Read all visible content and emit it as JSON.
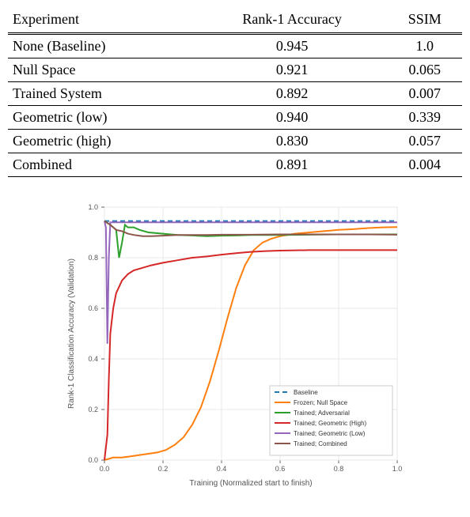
{
  "table": {
    "headers": [
      "Experiment",
      "Rank-1 Accuracy",
      "SSIM"
    ],
    "rows": [
      {
        "name": "None (Baseline)",
        "rank1": "0.945",
        "ssim": "1.0"
      },
      {
        "name": "Null Space",
        "rank1": "0.921",
        "ssim": "0.065"
      },
      {
        "name": "Trained System",
        "rank1": "0.892",
        "ssim": "0.007"
      },
      {
        "name": "Geometric (low)",
        "rank1": "0.940",
        "ssim": "0.339"
      },
      {
        "name": "Geometric (high)",
        "rank1": "0.830",
        "ssim": "0.057"
      },
      {
        "name": "Combined",
        "rank1": "0.891",
        "ssim": "0.004"
      }
    ]
  },
  "chart_data": {
    "type": "line",
    "title": "",
    "xlabel": "Training (Normalized start to finish)",
    "ylabel": "Rank-1 Classification Accuracy (Validation)",
    "xlim": [
      0.0,
      1.0
    ],
    "ylim": [
      0.0,
      1.0
    ],
    "xticks": [
      0.0,
      0.2,
      0.4,
      0.6,
      0.8,
      1.0
    ],
    "yticks": [
      0.0,
      0.2,
      0.4,
      0.6,
      0.8,
      1.0
    ],
    "series": [
      {
        "name": "Baseline",
        "color": "#1f77b4",
        "dash": "6,4",
        "data": [
          [
            0.0,
            0.945
          ],
          [
            1.0,
            0.945
          ]
        ]
      },
      {
        "name": "Frozen; Null Space",
        "color": "#ff7f0e",
        "dash": "",
        "data": [
          [
            0.0,
            0.0
          ],
          [
            0.03,
            0.01
          ],
          [
            0.06,
            0.01
          ],
          [
            0.09,
            0.015
          ],
          [
            0.12,
            0.02
          ],
          [
            0.15,
            0.025
          ],
          [
            0.18,
            0.03
          ],
          [
            0.21,
            0.04
          ],
          [
            0.24,
            0.06
          ],
          [
            0.27,
            0.09
          ],
          [
            0.3,
            0.14
          ],
          [
            0.33,
            0.21
          ],
          [
            0.36,
            0.31
          ],
          [
            0.39,
            0.43
          ],
          [
            0.42,
            0.56
          ],
          [
            0.45,
            0.68
          ],
          [
            0.48,
            0.77
          ],
          [
            0.51,
            0.83
          ],
          [
            0.54,
            0.86
          ],
          [
            0.57,
            0.875
          ],
          [
            0.6,
            0.885
          ],
          [
            0.65,
            0.895
          ],
          [
            0.7,
            0.9
          ],
          [
            0.75,
            0.905
          ],
          [
            0.8,
            0.91
          ],
          [
            0.85,
            0.913
          ],
          [
            0.9,
            0.917
          ],
          [
            0.95,
            0.92
          ],
          [
            1.0,
            0.921
          ]
        ]
      },
      {
        "name": "Trained; Adversarial",
        "color": "#2ca02c",
        "dash": "",
        "data": [
          [
            0.0,
            0.945
          ],
          [
            0.02,
            0.93
          ],
          [
            0.04,
            0.91
          ],
          [
            0.05,
            0.8
          ],
          [
            0.06,
            0.86
          ],
          [
            0.07,
            0.93
          ],
          [
            0.08,
            0.92
          ],
          [
            0.1,
            0.92
          ],
          [
            0.12,
            0.91
          ],
          [
            0.15,
            0.9
          ],
          [
            0.2,
            0.895
          ],
          [
            0.25,
            0.89
          ],
          [
            0.3,
            0.888
          ],
          [
            0.35,
            0.885
          ],
          [
            0.4,
            0.887
          ],
          [
            0.45,
            0.888
          ],
          [
            0.5,
            0.89
          ],
          [
            0.6,
            0.89
          ],
          [
            0.7,
            0.891
          ],
          [
            0.8,
            0.892
          ],
          [
            0.9,
            0.892
          ],
          [
            1.0,
            0.892
          ]
        ]
      },
      {
        "name": "Trained; Geometric (High)",
        "color": "#d62728",
        "dash": "",
        "data": [
          [
            0.0,
            0.0
          ],
          [
            0.01,
            0.1
          ],
          [
            0.015,
            0.32
          ],
          [
            0.02,
            0.5
          ],
          [
            0.03,
            0.6
          ],
          [
            0.04,
            0.66
          ],
          [
            0.06,
            0.71
          ],
          [
            0.08,
            0.735
          ],
          [
            0.1,
            0.75
          ],
          [
            0.13,
            0.76
          ],
          [
            0.16,
            0.77
          ],
          [
            0.2,
            0.78
          ],
          [
            0.25,
            0.79
          ],
          [
            0.3,
            0.8
          ],
          [
            0.35,
            0.805
          ],
          [
            0.4,
            0.812
          ],
          [
            0.45,
            0.818
          ],
          [
            0.5,
            0.823
          ],
          [
            0.55,
            0.826
          ],
          [
            0.6,
            0.828
          ],
          [
            0.7,
            0.83
          ],
          [
            0.8,
            0.83
          ],
          [
            0.9,
            0.83
          ],
          [
            1.0,
            0.83
          ]
        ]
      },
      {
        "name": "Trained; Geometric (Low)",
        "color": "#9467bd",
        "dash": "",
        "data": [
          [
            0.0,
            0.945
          ],
          [
            0.005,
            0.92
          ],
          [
            0.01,
            0.46
          ],
          [
            0.015,
            0.8
          ],
          [
            0.02,
            0.94
          ],
          [
            0.03,
            0.94
          ],
          [
            0.05,
            0.94
          ],
          [
            0.1,
            0.94
          ],
          [
            0.2,
            0.94
          ],
          [
            0.4,
            0.94
          ],
          [
            0.6,
            0.94
          ],
          [
            0.8,
            0.94
          ],
          [
            1.0,
            0.94
          ]
        ]
      },
      {
        "name": "Trained; Combined",
        "color": "#8c564b",
        "dash": "",
        "data": [
          [
            0.0,
            0.945
          ],
          [
            0.02,
            0.93
          ],
          [
            0.04,
            0.91
          ],
          [
            0.06,
            0.905
          ],
          [
            0.08,
            0.895
          ],
          [
            0.1,
            0.89
          ],
          [
            0.13,
            0.885
          ],
          [
            0.16,
            0.885
          ],
          [
            0.2,
            0.887
          ],
          [
            0.25,
            0.89
          ],
          [
            0.3,
            0.89
          ],
          [
            0.35,
            0.89
          ],
          [
            0.4,
            0.891
          ],
          [
            0.5,
            0.891
          ],
          [
            0.6,
            0.892
          ],
          [
            0.7,
            0.892
          ],
          [
            0.8,
            0.892
          ],
          [
            0.9,
            0.892
          ],
          [
            1.0,
            0.891
          ]
        ]
      }
    ]
  }
}
